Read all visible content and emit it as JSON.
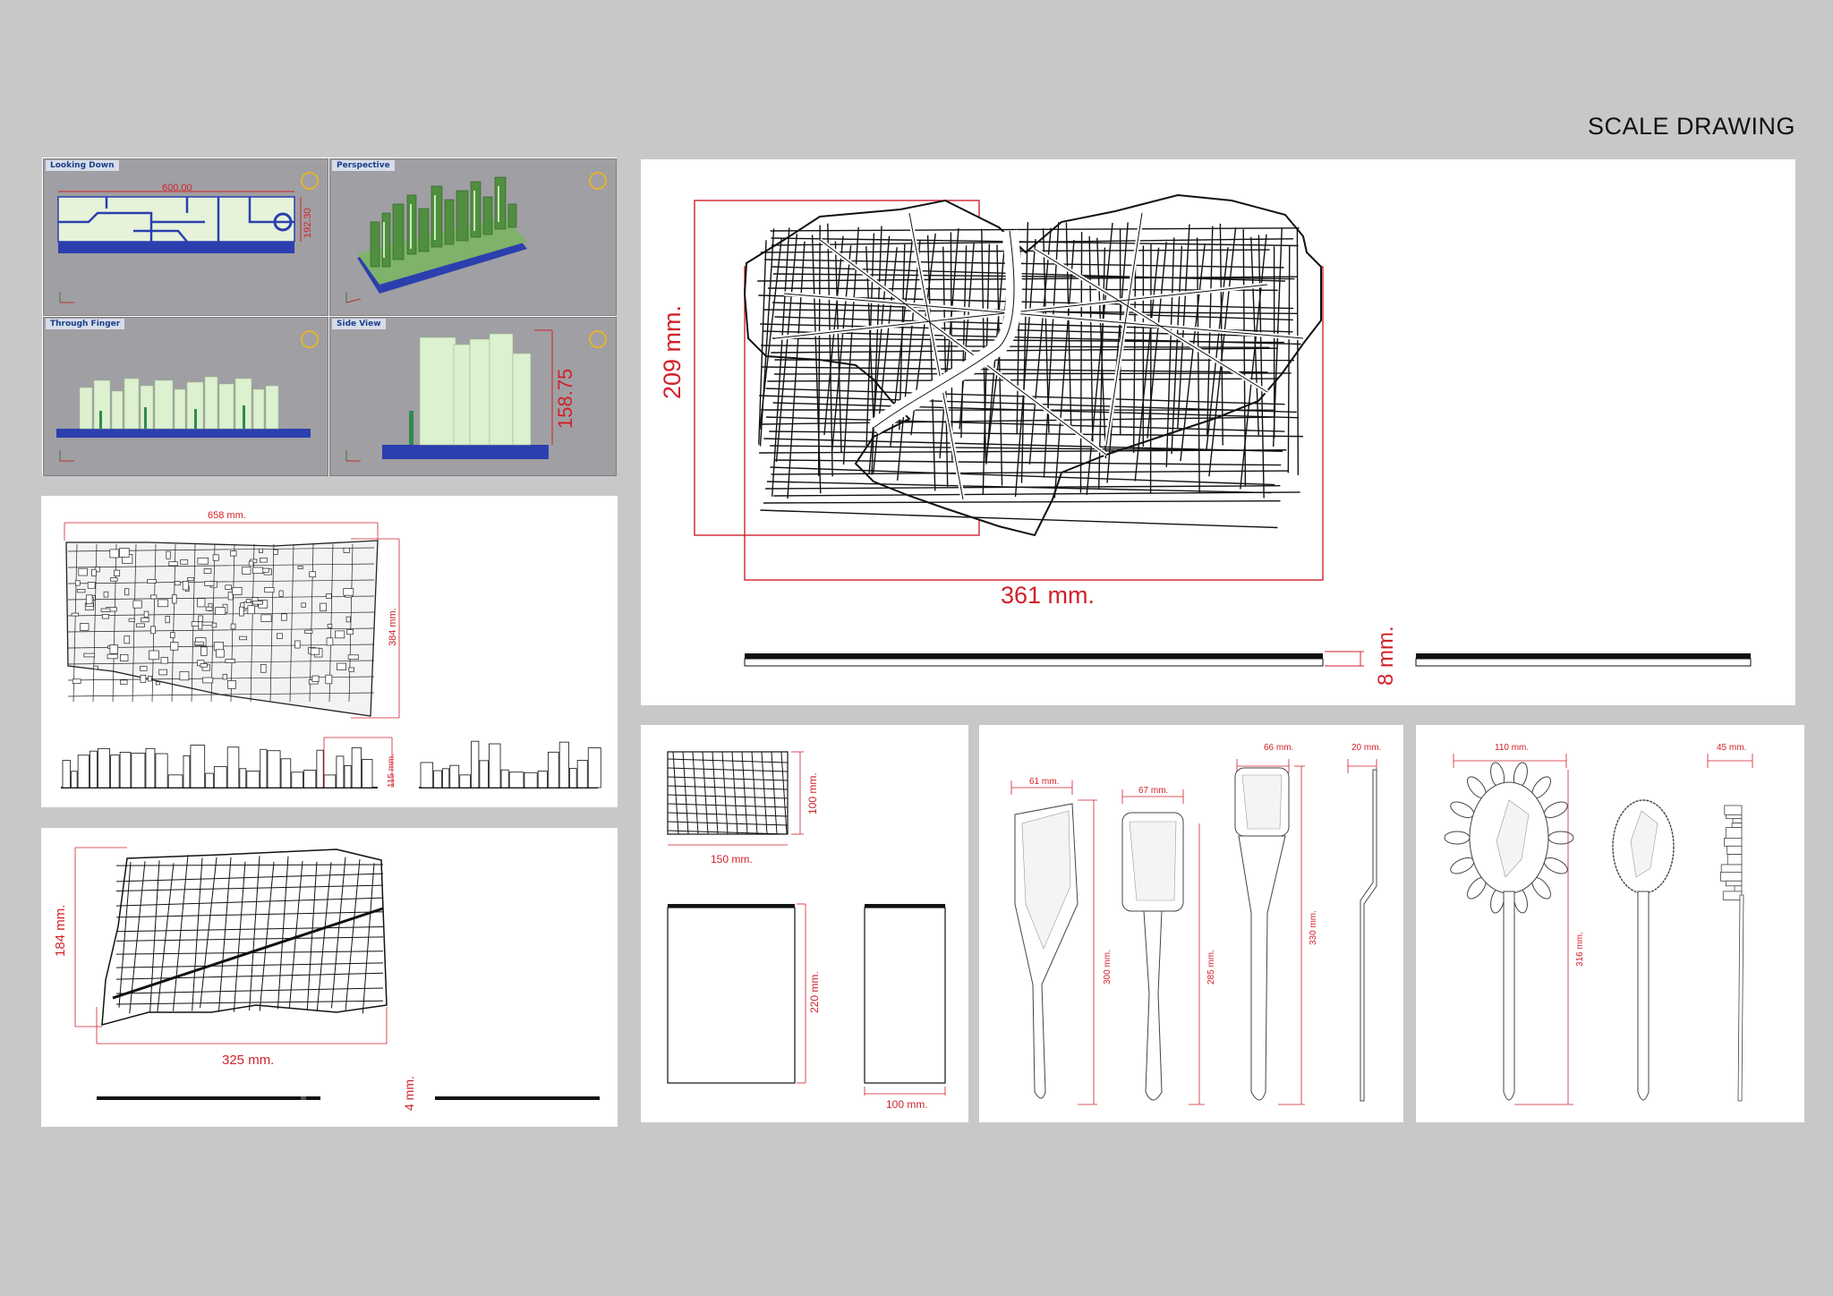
{
  "page": {
    "title": "SCALE DRAWING"
  },
  "rhino": {
    "viewports": [
      {
        "name": "Looking Down",
        "dims": [
          "600.00",
          "192.30"
        ]
      },
      {
        "name": "Perspective"
      },
      {
        "name": "Through Finger"
      },
      {
        "name": "Side View",
        "dims": [
          "158.75"
        ]
      }
    ],
    "axis_labels": {
      "x": "x",
      "y": "y"
    }
  },
  "panel_city_3d": {
    "width": "658 mm.",
    "height": "384 mm.",
    "skyline_height": "115 mm."
  },
  "panel_map_small": {
    "height": "184 mm.",
    "width": "325 mm.",
    "thickness": "4 mm."
  },
  "panel_map_large": {
    "height": "209 mm.",
    "width": "361 mm.",
    "thickness": "8 mm."
  },
  "panel_boxes": {
    "map_height": "100 mm.",
    "map_width": "150 mm.",
    "box_height": "220 mm.",
    "box_width": "100 mm."
  },
  "panel_spatulas": {
    "widths": [
      "61 mm.",
      "67 mm.",
      "66 mm.",
      "20 mm."
    ],
    "lengths": [
      "300 mm.",
      "285 mm.",
      "330 mm."
    ]
  },
  "panel_spoons": {
    "widths": [
      "110 mm.",
      "45 mm."
    ],
    "length": "316 mm."
  },
  "colors": {
    "background": "#c9c8c9",
    "dimension_red": "#d1212a",
    "panel": "#ffffff",
    "rhino_base_blue": "#2b3fae",
    "rhino_building_green": "#d9f2cc"
  }
}
